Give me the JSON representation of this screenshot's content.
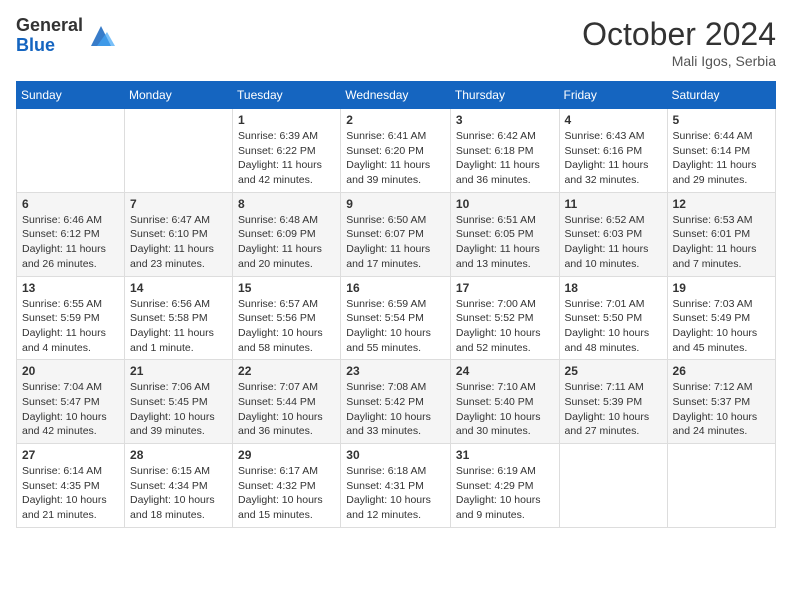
{
  "header": {
    "logo_general": "General",
    "logo_blue": "Blue",
    "month_title": "October 2024",
    "location": "Mali Igos, Serbia"
  },
  "days_of_week": [
    "Sunday",
    "Monday",
    "Tuesday",
    "Wednesday",
    "Thursday",
    "Friday",
    "Saturday"
  ],
  "weeks": [
    [
      {
        "day": "",
        "sunrise": "",
        "sunset": "",
        "daylight": ""
      },
      {
        "day": "",
        "sunrise": "",
        "sunset": "",
        "daylight": ""
      },
      {
        "day": "1",
        "sunrise": "Sunrise: 6:39 AM",
        "sunset": "Sunset: 6:22 PM",
        "daylight": "Daylight: 11 hours and 42 minutes."
      },
      {
        "day": "2",
        "sunrise": "Sunrise: 6:41 AM",
        "sunset": "Sunset: 6:20 PM",
        "daylight": "Daylight: 11 hours and 39 minutes."
      },
      {
        "day": "3",
        "sunrise": "Sunrise: 6:42 AM",
        "sunset": "Sunset: 6:18 PM",
        "daylight": "Daylight: 11 hours and 36 minutes."
      },
      {
        "day": "4",
        "sunrise": "Sunrise: 6:43 AM",
        "sunset": "Sunset: 6:16 PM",
        "daylight": "Daylight: 11 hours and 32 minutes."
      },
      {
        "day": "5",
        "sunrise": "Sunrise: 6:44 AM",
        "sunset": "Sunset: 6:14 PM",
        "daylight": "Daylight: 11 hours and 29 minutes."
      }
    ],
    [
      {
        "day": "6",
        "sunrise": "Sunrise: 6:46 AM",
        "sunset": "Sunset: 6:12 PM",
        "daylight": "Daylight: 11 hours and 26 minutes."
      },
      {
        "day": "7",
        "sunrise": "Sunrise: 6:47 AM",
        "sunset": "Sunset: 6:10 PM",
        "daylight": "Daylight: 11 hours and 23 minutes."
      },
      {
        "day": "8",
        "sunrise": "Sunrise: 6:48 AM",
        "sunset": "Sunset: 6:09 PM",
        "daylight": "Daylight: 11 hours and 20 minutes."
      },
      {
        "day": "9",
        "sunrise": "Sunrise: 6:50 AM",
        "sunset": "Sunset: 6:07 PM",
        "daylight": "Daylight: 11 hours and 17 minutes."
      },
      {
        "day": "10",
        "sunrise": "Sunrise: 6:51 AM",
        "sunset": "Sunset: 6:05 PM",
        "daylight": "Daylight: 11 hours and 13 minutes."
      },
      {
        "day": "11",
        "sunrise": "Sunrise: 6:52 AM",
        "sunset": "Sunset: 6:03 PM",
        "daylight": "Daylight: 11 hours and 10 minutes."
      },
      {
        "day": "12",
        "sunrise": "Sunrise: 6:53 AM",
        "sunset": "Sunset: 6:01 PM",
        "daylight": "Daylight: 11 hours and 7 minutes."
      }
    ],
    [
      {
        "day": "13",
        "sunrise": "Sunrise: 6:55 AM",
        "sunset": "Sunset: 5:59 PM",
        "daylight": "Daylight: 11 hours and 4 minutes."
      },
      {
        "day": "14",
        "sunrise": "Sunrise: 6:56 AM",
        "sunset": "Sunset: 5:58 PM",
        "daylight": "Daylight: 11 hours and 1 minute."
      },
      {
        "day": "15",
        "sunrise": "Sunrise: 6:57 AM",
        "sunset": "Sunset: 5:56 PM",
        "daylight": "Daylight: 10 hours and 58 minutes."
      },
      {
        "day": "16",
        "sunrise": "Sunrise: 6:59 AM",
        "sunset": "Sunset: 5:54 PM",
        "daylight": "Daylight: 10 hours and 55 minutes."
      },
      {
        "day": "17",
        "sunrise": "Sunrise: 7:00 AM",
        "sunset": "Sunset: 5:52 PM",
        "daylight": "Daylight: 10 hours and 52 minutes."
      },
      {
        "day": "18",
        "sunrise": "Sunrise: 7:01 AM",
        "sunset": "Sunset: 5:50 PM",
        "daylight": "Daylight: 10 hours and 48 minutes."
      },
      {
        "day": "19",
        "sunrise": "Sunrise: 7:03 AM",
        "sunset": "Sunset: 5:49 PM",
        "daylight": "Daylight: 10 hours and 45 minutes."
      }
    ],
    [
      {
        "day": "20",
        "sunrise": "Sunrise: 7:04 AM",
        "sunset": "Sunset: 5:47 PM",
        "daylight": "Daylight: 10 hours and 42 minutes."
      },
      {
        "day": "21",
        "sunrise": "Sunrise: 7:06 AM",
        "sunset": "Sunset: 5:45 PM",
        "daylight": "Daylight: 10 hours and 39 minutes."
      },
      {
        "day": "22",
        "sunrise": "Sunrise: 7:07 AM",
        "sunset": "Sunset: 5:44 PM",
        "daylight": "Daylight: 10 hours and 36 minutes."
      },
      {
        "day": "23",
        "sunrise": "Sunrise: 7:08 AM",
        "sunset": "Sunset: 5:42 PM",
        "daylight": "Daylight: 10 hours and 33 minutes."
      },
      {
        "day": "24",
        "sunrise": "Sunrise: 7:10 AM",
        "sunset": "Sunset: 5:40 PM",
        "daylight": "Daylight: 10 hours and 30 minutes."
      },
      {
        "day": "25",
        "sunrise": "Sunrise: 7:11 AM",
        "sunset": "Sunset: 5:39 PM",
        "daylight": "Daylight: 10 hours and 27 minutes."
      },
      {
        "day": "26",
        "sunrise": "Sunrise: 7:12 AM",
        "sunset": "Sunset: 5:37 PM",
        "daylight": "Daylight: 10 hours and 24 minutes."
      }
    ],
    [
      {
        "day": "27",
        "sunrise": "Sunrise: 6:14 AM",
        "sunset": "Sunset: 4:35 PM",
        "daylight": "Daylight: 10 hours and 21 minutes."
      },
      {
        "day": "28",
        "sunrise": "Sunrise: 6:15 AM",
        "sunset": "Sunset: 4:34 PM",
        "daylight": "Daylight: 10 hours and 18 minutes."
      },
      {
        "day": "29",
        "sunrise": "Sunrise: 6:17 AM",
        "sunset": "Sunset: 4:32 PM",
        "daylight": "Daylight: 10 hours and 15 minutes."
      },
      {
        "day": "30",
        "sunrise": "Sunrise: 6:18 AM",
        "sunset": "Sunset: 4:31 PM",
        "daylight": "Daylight: 10 hours and 12 minutes."
      },
      {
        "day": "31",
        "sunrise": "Sunrise: 6:19 AM",
        "sunset": "Sunset: 4:29 PM",
        "daylight": "Daylight: 10 hours and 9 minutes."
      },
      {
        "day": "",
        "sunrise": "",
        "sunset": "",
        "daylight": ""
      },
      {
        "day": "",
        "sunrise": "",
        "sunset": "",
        "daylight": ""
      }
    ]
  ]
}
